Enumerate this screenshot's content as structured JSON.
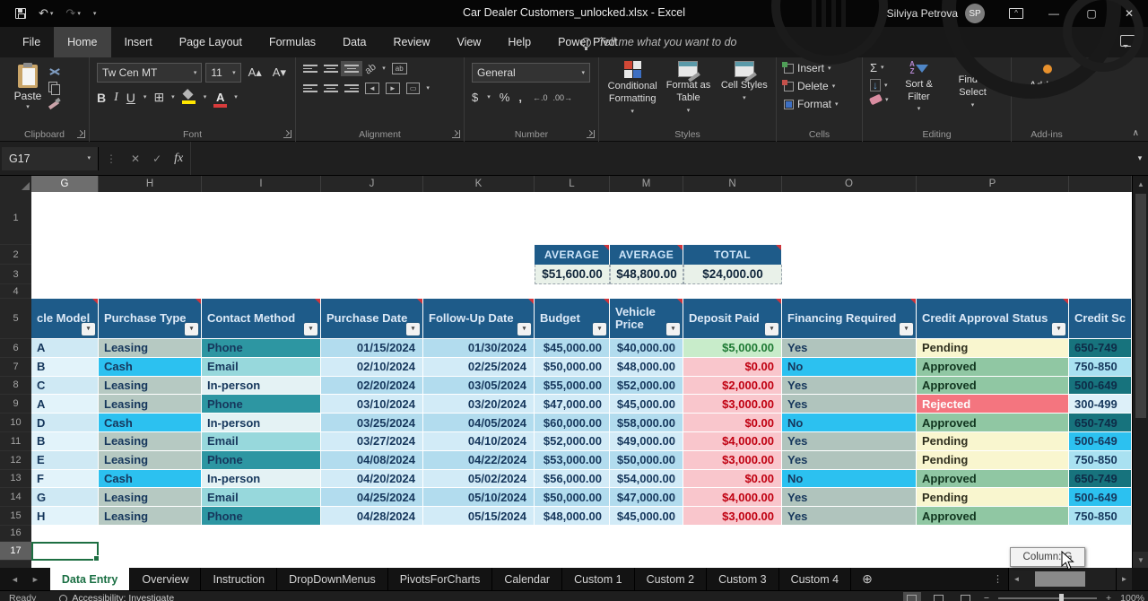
{
  "titlebar": {
    "title": "Car Dealer Customers_unlocked.xlsx  -  Excel",
    "user": "Silviya Petrova",
    "initials": "SP"
  },
  "menu": {
    "tabs": [
      {
        "label": "File",
        "active": false
      },
      {
        "label": "Home",
        "active": true
      },
      {
        "label": "Insert",
        "active": false
      },
      {
        "label": "Page Layout",
        "active": false
      },
      {
        "label": "Formulas",
        "active": false
      },
      {
        "label": "Data",
        "active": false
      },
      {
        "label": "Review",
        "active": false
      },
      {
        "label": "View",
        "active": false
      },
      {
        "label": "Help",
        "active": false
      },
      {
        "label": "Power Pivot",
        "active": false
      }
    ],
    "tell_me": "Tell me what you want to do"
  },
  "ribbon": {
    "clipboard": {
      "label": "Clipboard",
      "paste": "Paste"
    },
    "font": {
      "label": "Font",
      "name": "Tw Cen MT",
      "size": "11",
      "bold": "B",
      "italic": "I",
      "underline": "U"
    },
    "alignment": {
      "label": "Alignment"
    },
    "number": {
      "label": "Number",
      "format": "General",
      "dollar": "$",
      "percent": "%",
      "comma": ",",
      "dec_inc": "←.0",
      "dec_dec": ".00→"
    },
    "styles": {
      "label": "Styles",
      "cf": "Conditional Formatting",
      "fat": "Format as Table",
      "cs": "Cell Styles"
    },
    "cells": {
      "label": "Cells",
      "insert": "Insert",
      "delete": "Delete",
      "format": "Format"
    },
    "editing": {
      "label": "Editing",
      "sigma": "Σ",
      "sort": "Sort & Filter",
      "find": "Find & Select"
    },
    "addins": {
      "label": "Add-ins",
      "button": "Add-ins"
    }
  },
  "formula": {
    "name_box": "G17"
  },
  "icons": {
    "undo": "↶",
    "redo": "↷",
    "chev": "▾",
    "close": "✕",
    "minimize": "—",
    "restore": "▢",
    "cancel": "✕",
    "check": "✓",
    "fx": "fx",
    "kebab": "⋮",
    "collapse": "∧",
    "left": "◄",
    "right": "►",
    "up": "▲",
    "down": "▼",
    "plus": "⊕",
    "borders": "⊞",
    "fill_arrow": "↓",
    "diag": "ab",
    "merge": "▭",
    "a_up": "A▴",
    "a_down": "A▾"
  },
  "grid": {
    "columns": [
      {
        "letter": "G",
        "width": 75,
        "selected": true
      },
      {
        "letter": "H",
        "width": 115,
        "selected": false
      },
      {
        "letter": "I",
        "width": 133,
        "selected": false
      },
      {
        "letter": "J",
        "width": 114,
        "selected": false
      },
      {
        "letter": "K",
        "width": 124,
        "selected": false
      },
      {
        "letter": "L",
        "width": 84,
        "selected": false
      },
      {
        "letter": "M",
        "width": 82,
        "selected": false
      },
      {
        "letter": "N",
        "width": 110,
        "selected": false
      },
      {
        "letter": "O",
        "width": 150,
        "selected": false
      },
      {
        "letter": "P",
        "width": 170,
        "selected": false
      },
      {
        "letter": "",
        "width": 70,
        "selected": false
      }
    ],
    "rows": [
      {
        "n": "1",
        "h": 59,
        "selected": false
      },
      {
        "n": "2",
        "h": 22,
        "selected": false
      },
      {
        "n": "3",
        "h": 22,
        "selected": false
      },
      {
        "n": "4",
        "h": 16,
        "selected": false
      },
      {
        "n": "5",
        "h": 45,
        "selected": false
      },
      {
        "n": "6",
        "h": 20.8,
        "selected": false
      },
      {
        "n": "7",
        "h": 20.8,
        "selected": false
      },
      {
        "n": "8",
        "h": 20.8,
        "selected": false
      },
      {
        "n": "9",
        "h": 20.8,
        "selected": false
      },
      {
        "n": "10",
        "h": 20.8,
        "selected": false
      },
      {
        "n": "11",
        "h": 20.8,
        "selected": false
      },
      {
        "n": "12",
        "h": 20.8,
        "selected": false
      },
      {
        "n": "13",
        "h": 20.8,
        "selected": false
      },
      {
        "n": "14",
        "h": 20.8,
        "selected": false
      },
      {
        "n": "15",
        "h": 20.8,
        "selected": false
      },
      {
        "n": "16",
        "h": 18,
        "selected": false
      },
      {
        "n": "17",
        "h": 21,
        "selected": true
      }
    ]
  },
  "summary": {
    "cols": [
      {
        "header": "AVERAGE",
        "value": "$51,600.00",
        "w": 84
      },
      {
        "header": "AVERAGE",
        "value": "$48,800.00",
        "w": 82
      },
      {
        "header": "TOTAL",
        "value": "$24,000.00",
        "w": 110
      }
    ]
  },
  "table": {
    "headers": [
      "cle Model",
      "Purchase Type",
      "Contact Method",
      "Purchase Date",
      "Follow-Up Date",
      "Budget",
      "Vehicle Price",
      "Deposit Paid",
      "Financing Required",
      "Credit Approval Status",
      "Credit Sc"
    ],
    "rows": [
      [
        [
          "A",
          ""
        ],
        [
          "Leasing",
          "leasing"
        ],
        [
          "Phone",
          "phone"
        ],
        [
          "01/15/2024",
          ""
        ],
        [
          "01/30/2024",
          ""
        ],
        [
          "$45,000.00",
          ""
        ],
        [
          "$40,000.00",
          ""
        ],
        [
          "$5,000.00",
          "dep-g"
        ],
        [
          "Yes",
          "yes"
        ],
        [
          "Pending",
          "pending"
        ],
        [
          "650-749",
          "cr-dark"
        ]
      ],
      [
        [
          "B",
          ""
        ],
        [
          "Cash",
          "cash"
        ],
        [
          "Email",
          "email"
        ],
        [
          "02/10/2024",
          ""
        ],
        [
          "02/25/2024",
          ""
        ],
        [
          "$50,000.00",
          ""
        ],
        [
          "$48,000.00",
          ""
        ],
        [
          "$0.00",
          "dep-p"
        ],
        [
          "No",
          "no"
        ],
        [
          "Approved",
          "approved"
        ],
        [
          "750-850",
          "cr-lt"
        ]
      ],
      [
        [
          "C",
          ""
        ],
        [
          "Leasing",
          "leasing"
        ],
        [
          "In-person",
          "inperson"
        ],
        [
          "02/20/2024",
          ""
        ],
        [
          "03/05/2024",
          ""
        ],
        [
          "$55,000.00",
          ""
        ],
        [
          "$52,000.00",
          ""
        ],
        [
          "$2,000.00",
          "dep-p"
        ],
        [
          "Yes",
          "yes"
        ],
        [
          "Approved",
          "approved"
        ],
        [
          "500-649",
          "cr-dark"
        ]
      ],
      [
        [
          "A",
          ""
        ],
        [
          "Leasing",
          "leasing"
        ],
        [
          "Phone",
          "phone"
        ],
        [
          "03/10/2024",
          ""
        ],
        [
          "03/20/2024",
          ""
        ],
        [
          "$47,000.00",
          ""
        ],
        [
          "$45,000.00",
          ""
        ],
        [
          "$3,000.00",
          "dep-p"
        ],
        [
          "Yes",
          "yes"
        ],
        [
          "Rejected",
          "rejected"
        ],
        [
          "300-499",
          "cr-pale"
        ]
      ],
      [
        [
          "D",
          ""
        ],
        [
          "Cash",
          "cash"
        ],
        [
          "In-person",
          "inperson"
        ],
        [
          "03/25/2024",
          ""
        ],
        [
          "04/05/2024",
          ""
        ],
        [
          "$60,000.00",
          ""
        ],
        [
          "$58,000.00",
          ""
        ],
        [
          "$0.00",
          "dep-p"
        ],
        [
          "No",
          "no"
        ],
        [
          "Approved",
          "approved"
        ],
        [
          "650-749",
          "cr-dark"
        ]
      ],
      [
        [
          "B",
          ""
        ],
        [
          "Leasing",
          "leasing"
        ],
        [
          "Email",
          "email"
        ],
        [
          "03/27/2024",
          ""
        ],
        [
          "04/10/2024",
          ""
        ],
        [
          "$52,000.00",
          ""
        ],
        [
          "$49,000.00",
          ""
        ],
        [
          "$4,000.00",
          "dep-p"
        ],
        [
          "Yes",
          "yes"
        ],
        [
          "Pending",
          "pending"
        ],
        [
          "500-649",
          "cr-cyan"
        ]
      ],
      [
        [
          "E",
          ""
        ],
        [
          "Leasing",
          "leasing"
        ],
        [
          "Phone",
          "phone"
        ],
        [
          "04/08/2024",
          ""
        ],
        [
          "04/22/2024",
          ""
        ],
        [
          "$53,000.00",
          ""
        ],
        [
          "$50,000.00",
          ""
        ],
        [
          "$3,000.00",
          "dep-p"
        ],
        [
          "Yes",
          "yes"
        ],
        [
          "Pending",
          "pending"
        ],
        [
          "750-850",
          "cr-lt"
        ]
      ],
      [
        [
          "F",
          ""
        ],
        [
          "Cash",
          "cash"
        ],
        [
          "In-person",
          "inperson"
        ],
        [
          "04/20/2024",
          ""
        ],
        [
          "05/02/2024",
          ""
        ],
        [
          "$56,000.00",
          ""
        ],
        [
          "$54,000.00",
          ""
        ],
        [
          "$0.00",
          "dep-p"
        ],
        [
          "No",
          "no"
        ],
        [
          "Approved",
          "approved"
        ],
        [
          "650-749",
          "cr-dark"
        ]
      ],
      [
        [
          "G",
          ""
        ],
        [
          "Leasing",
          "leasing"
        ],
        [
          "Email",
          "email"
        ],
        [
          "04/25/2024",
          ""
        ],
        [
          "05/10/2024",
          ""
        ],
        [
          "$50,000.00",
          ""
        ],
        [
          "$47,000.00",
          ""
        ],
        [
          "$4,000.00",
          "dep-p"
        ],
        [
          "Yes",
          "yes"
        ],
        [
          "Pending",
          "pending"
        ],
        [
          "500-649",
          "cr-cyan"
        ]
      ],
      [
        [
          "H",
          ""
        ],
        [
          "Leasing",
          "leasing"
        ],
        [
          "Phone",
          "phone"
        ],
        [
          "04/28/2024",
          ""
        ],
        [
          "05/15/2024",
          ""
        ],
        [
          "$48,000.00",
          ""
        ],
        [
          "$45,000.00",
          ""
        ],
        [
          "$3,000.00",
          "dep-p"
        ],
        [
          "Yes",
          "yes"
        ],
        [
          "Approved",
          "approved"
        ],
        [
          "750-850",
          "cr-lt"
        ]
      ]
    ]
  },
  "sheet_tabs": [
    {
      "label": "Data Entry",
      "active": true
    },
    {
      "label": "Overview",
      "active": false
    },
    {
      "label": "Instruction",
      "active": false
    },
    {
      "label": "DropDownMenus",
      "active": false
    },
    {
      "label": "PivotsForCharts",
      "active": false
    },
    {
      "label": "Calendar",
      "active": false
    },
    {
      "label": "Custom 1",
      "active": false
    },
    {
      "label": "Custom 2",
      "active": false
    },
    {
      "label": "Custom 3",
      "active": false
    },
    {
      "label": "Custom 4",
      "active": false
    }
  ],
  "scroll_tooltip": "Column: G",
  "status": {
    "ready": "Ready",
    "accessibility": "Accessibility: Investigate",
    "zoom": "100%",
    "zoom_minus": "−",
    "zoom_plus": "+"
  }
}
